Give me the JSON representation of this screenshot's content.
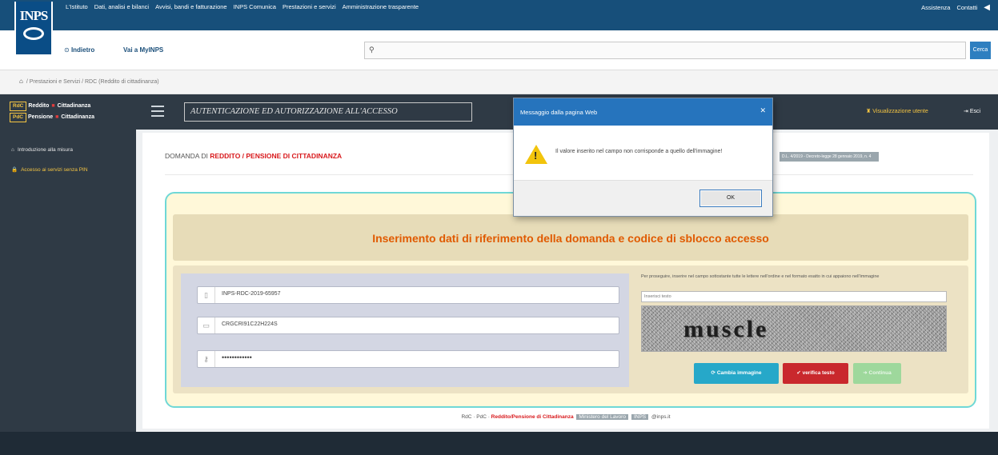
{
  "topbar": {
    "nav": [
      "L'Istituto",
      "Dati, analisi e bilanci",
      "Avvisi, bandi e fatturazione",
      "INPS Comunica",
      "Prestazioni e servizi",
      "Amministrazione trasparente"
    ],
    "assistenza": "Assistenza",
    "contatti": "Contatti",
    "logo_text": "INPS"
  },
  "bar2": {
    "back": "Indietro",
    "myinps": "Vai a MyINPS",
    "search_button": "Cerca"
  },
  "breadcrumb": [
    "Prestazioni e Servizi",
    "RDC (Reddito di cittadinanza)"
  ],
  "app_header": {
    "brand_line1_tag": "RdC",
    "brand_line1_a": "Reddito",
    "brand_line1_b": "Cittadinanza",
    "brand_line2_tag": "PdC",
    "brand_line2_a": "Pensione",
    "brand_line2_b": "Cittadinanza",
    "title": "AUTENTICAZIONE ED AUTORIZZAZIONE ALL'ACCESSO",
    "user_link": "Visualizzazione utente",
    "logout": "Esci"
  },
  "sidebar": {
    "items": [
      {
        "label": "Introduzione alla misura"
      },
      {
        "label": "Accesso ai servizi senza PIN"
      }
    ]
  },
  "main": {
    "domanda_prefix": "DOMANDA DI ",
    "domanda_highlight": "REDDITO / PENSIONE DI CITTADINANZA",
    "badge": "D.L. 4/2019 - Decreto-legge 28 gennaio 2019, n. 4",
    "panel_title": "Inserimento dati di riferimento della domanda e codice di sblocco accesso",
    "fields": [
      {
        "value": "INPS-RDC-2019-65957"
      },
      {
        "value": "CRGCRI91C22H224S"
      },
      {
        "value": "••••••••••••"
      }
    ],
    "captcha_hint": "Per proseguire, inserire nel campo sottostante tutte le lettere nell'ordine e nel formato esatto in cui appaiono nell'immagine",
    "captcha_placeholder": "Inserisci testo",
    "captcha_word": "muscle",
    "btn_cambia": "Cambia immagine",
    "btn_verifica": "verifica testo",
    "btn_continua": "Continua"
  },
  "footer": {
    "text1": "RdC · PdC · ",
    "text2": "Reddito/Pensione di Cittadinanza",
    "badge1": "Ministero del Lavoro",
    "badge2": "INPS",
    "text3": "@inps.it"
  },
  "dialog": {
    "title": "Messaggio dalla pagina Web",
    "message": "Il valore inserito nel campo non corrisponde a quello dell'immagine!",
    "ok": "OK"
  },
  "colors": {
    "topbar": "#174f7a",
    "dark_header": "#2f3a45",
    "highlight_red": "#d8191c",
    "title_orange": "#e05a00",
    "panel_border": "#6fd8d6"
  }
}
